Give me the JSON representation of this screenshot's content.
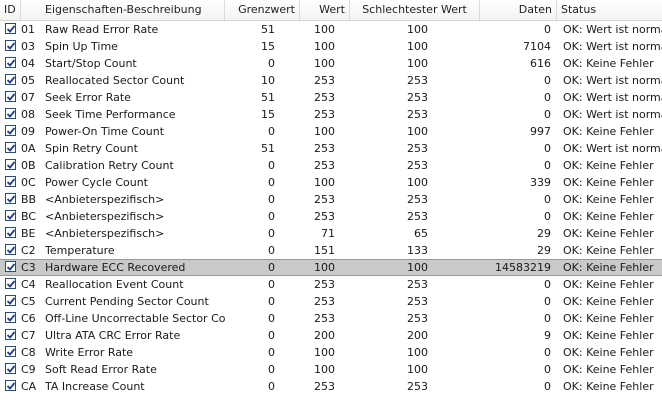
{
  "columns": {
    "id": "ID",
    "name": "Eigenschaften-Beschreibung",
    "threshold": "Grenzwert",
    "value": "Wert",
    "worst": "Schlechtester Wert",
    "raw": "Daten",
    "status": "Status"
  },
  "rows": [
    {
      "id": "01",
      "name": "Raw Read Error Rate",
      "threshold": "51",
      "value": "100",
      "worst": "100",
      "raw": "0",
      "status": "OK: Wert ist normal"
    },
    {
      "id": "03",
      "name": "Spin Up Time",
      "threshold": "15",
      "value": "100",
      "worst": "100",
      "raw": "7104",
      "status": "OK: Wert ist normal"
    },
    {
      "id": "04",
      "name": "Start/Stop Count",
      "threshold": "0",
      "value": "100",
      "worst": "100",
      "raw": "616",
      "status": "OK: Keine Fehler"
    },
    {
      "id": "05",
      "name": "Reallocated Sector Count",
      "threshold": "10",
      "value": "253",
      "worst": "253",
      "raw": "0",
      "status": "OK: Wert ist normal"
    },
    {
      "id": "07",
      "name": "Seek Error Rate",
      "threshold": "51",
      "value": "253",
      "worst": "253",
      "raw": "0",
      "status": "OK: Wert ist normal"
    },
    {
      "id": "08",
      "name": "Seek Time Performance",
      "threshold": "15",
      "value": "253",
      "worst": "253",
      "raw": "0",
      "status": "OK: Wert ist normal"
    },
    {
      "id": "09",
      "name": "Power-On Time Count",
      "threshold": "0",
      "value": "100",
      "worst": "100",
      "raw": "997",
      "status": "OK: Keine Fehler"
    },
    {
      "id": "0A",
      "name": "Spin Retry Count",
      "threshold": "51",
      "value": "253",
      "worst": "253",
      "raw": "0",
      "status": "OK: Wert ist normal"
    },
    {
      "id": "0B",
      "name": "Calibration Retry Count",
      "threshold": "0",
      "value": "253",
      "worst": "253",
      "raw": "0",
      "status": "OK: Keine Fehler"
    },
    {
      "id": "0C",
      "name": "Power Cycle Count",
      "threshold": "0",
      "value": "100",
      "worst": "100",
      "raw": "339",
      "status": "OK: Keine Fehler"
    },
    {
      "id": "BB",
      "name": "<Anbieterspezifisch>",
      "threshold": "0",
      "value": "253",
      "worst": "253",
      "raw": "0",
      "status": "OK: Keine Fehler"
    },
    {
      "id": "BC",
      "name": "<Anbieterspezifisch>",
      "threshold": "0",
      "value": "253",
      "worst": "253",
      "raw": "0",
      "status": "OK: Keine Fehler"
    },
    {
      "id": "BE",
      "name": "<Anbieterspezifisch>",
      "threshold": "0",
      "value": "71",
      "worst": "65",
      "raw": "29",
      "status": "OK: Keine Fehler"
    },
    {
      "id": "C2",
      "name": "Temperature",
      "threshold": "0",
      "value": "151",
      "worst": "133",
      "raw": "29",
      "status": "OK: Keine Fehler"
    },
    {
      "id": "C3",
      "name": "Hardware ECC Recovered",
      "threshold": "0",
      "value": "100",
      "worst": "100",
      "raw": "14583219",
      "status": "OK: Keine Fehler",
      "selected": true
    },
    {
      "id": "C4",
      "name": "Reallocation Event Count",
      "threshold": "0",
      "value": "253",
      "worst": "253",
      "raw": "0",
      "status": "OK: Keine Fehler"
    },
    {
      "id": "C5",
      "name": "Current Pending Sector Count",
      "threshold": "0",
      "value": "253",
      "worst": "253",
      "raw": "0",
      "status": "OK: Keine Fehler"
    },
    {
      "id": "C6",
      "name": "Off-Line Uncorrectable Sector Count",
      "threshold": "0",
      "value": "253",
      "worst": "253",
      "raw": "0",
      "status": "OK: Keine Fehler"
    },
    {
      "id": "C7",
      "name": "Ultra ATA CRC Error Rate",
      "threshold": "0",
      "value": "200",
      "worst": "200",
      "raw": "9",
      "status": "OK: Keine Fehler"
    },
    {
      "id": "C8",
      "name": "Write Error Rate",
      "threshold": "0",
      "value": "100",
      "worst": "100",
      "raw": "0",
      "status": "OK: Keine Fehler"
    },
    {
      "id": "C9",
      "name": "Soft Read Error Rate",
      "threshold": "0",
      "value": "100",
      "worst": "100",
      "raw": "0",
      "status": "OK: Keine Fehler"
    },
    {
      "id": "CA",
      "name": "TA Increase Count",
      "threshold": "0",
      "value": "253",
      "worst": "253",
      "raw": "0",
      "status": "OK: Keine Fehler"
    }
  ],
  "colors": {
    "selected_row": "#c9c9c9",
    "checkbox_border": "#1c5180",
    "checkmark": "#1c3f8f"
  }
}
